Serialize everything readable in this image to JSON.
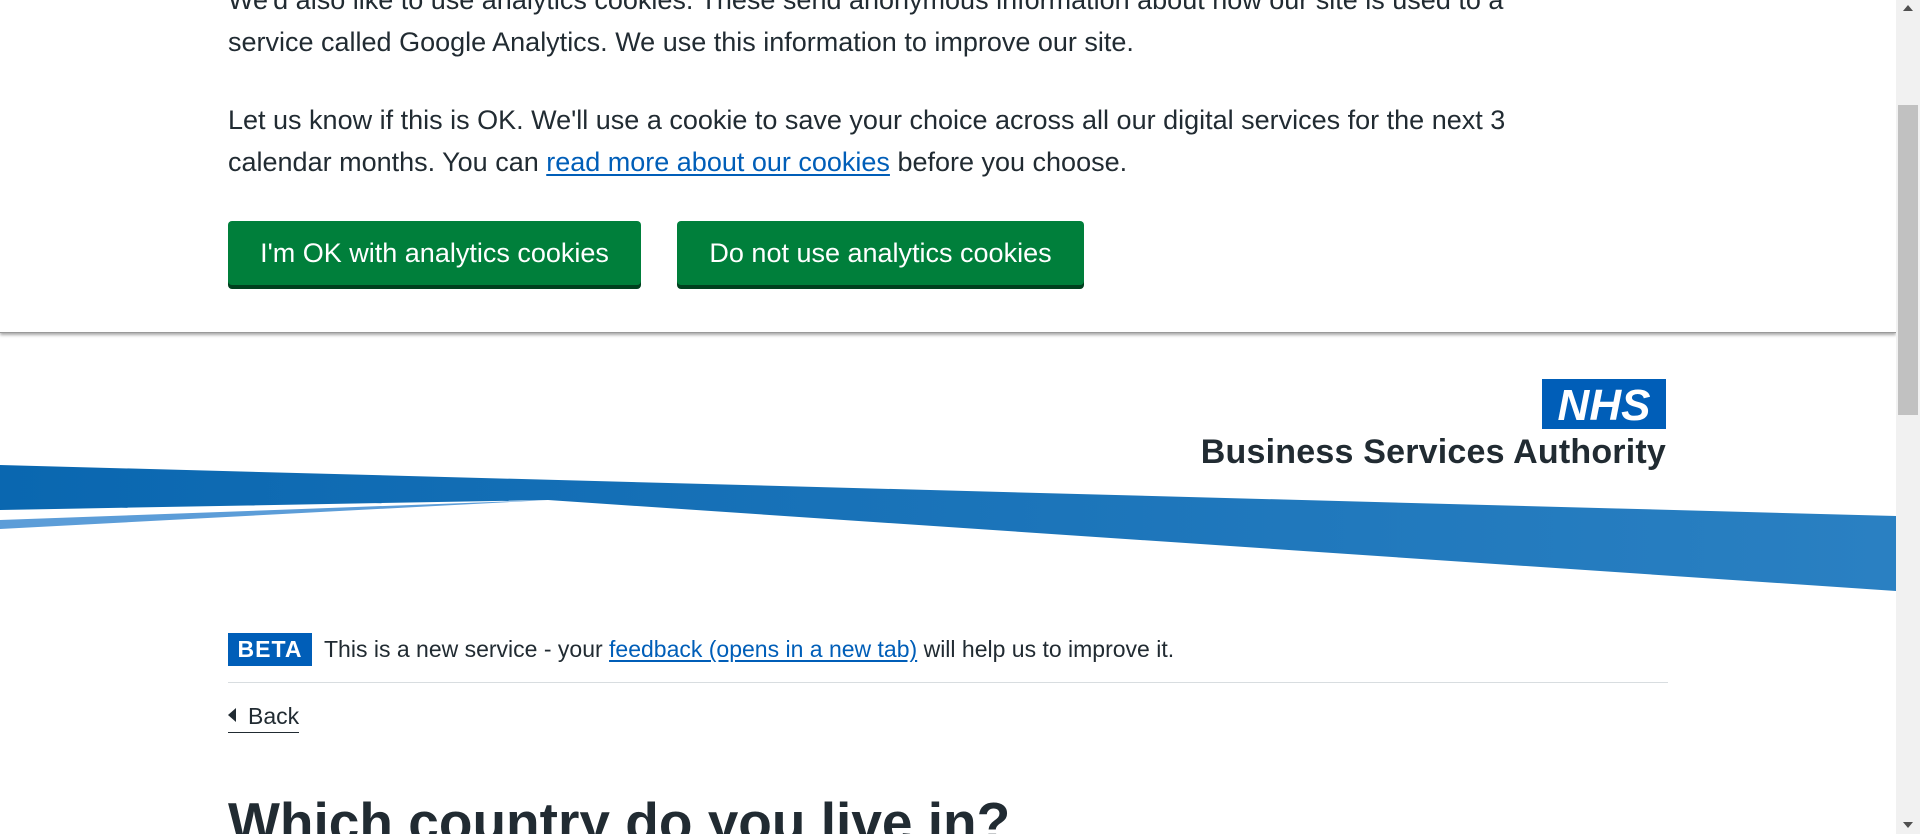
{
  "cookie_banner": {
    "paragraph1": "We'd also like to use analytics cookies. These send anonymous information about how our site is used to a service called Google Analytics. We use this information to improve our site.",
    "paragraph2_before": "Let us know if this is OK. We'll use a cookie to save your choice across all our digital services for the next 3 calendar months. You can ",
    "paragraph2_link": "read more about our cookies",
    "paragraph2_after": " before you choose.",
    "accept_label": "I'm OK with analytics cookies",
    "reject_label": "Do not use analytics cookies"
  },
  "header": {
    "logo_text": "NHS",
    "org_name": "Business Services Authority"
  },
  "phase_banner": {
    "tag": "BETA",
    "text_before": "This is a new service - your ",
    "link": "feedback (opens in a new tab)",
    "text_after": " will help us to improve it."
  },
  "back_link": "Back",
  "page_heading": "Which country do you live in?",
  "colors": {
    "nhs_blue": "#005eb8",
    "button_green": "#007f3b",
    "text": "#212b32"
  }
}
